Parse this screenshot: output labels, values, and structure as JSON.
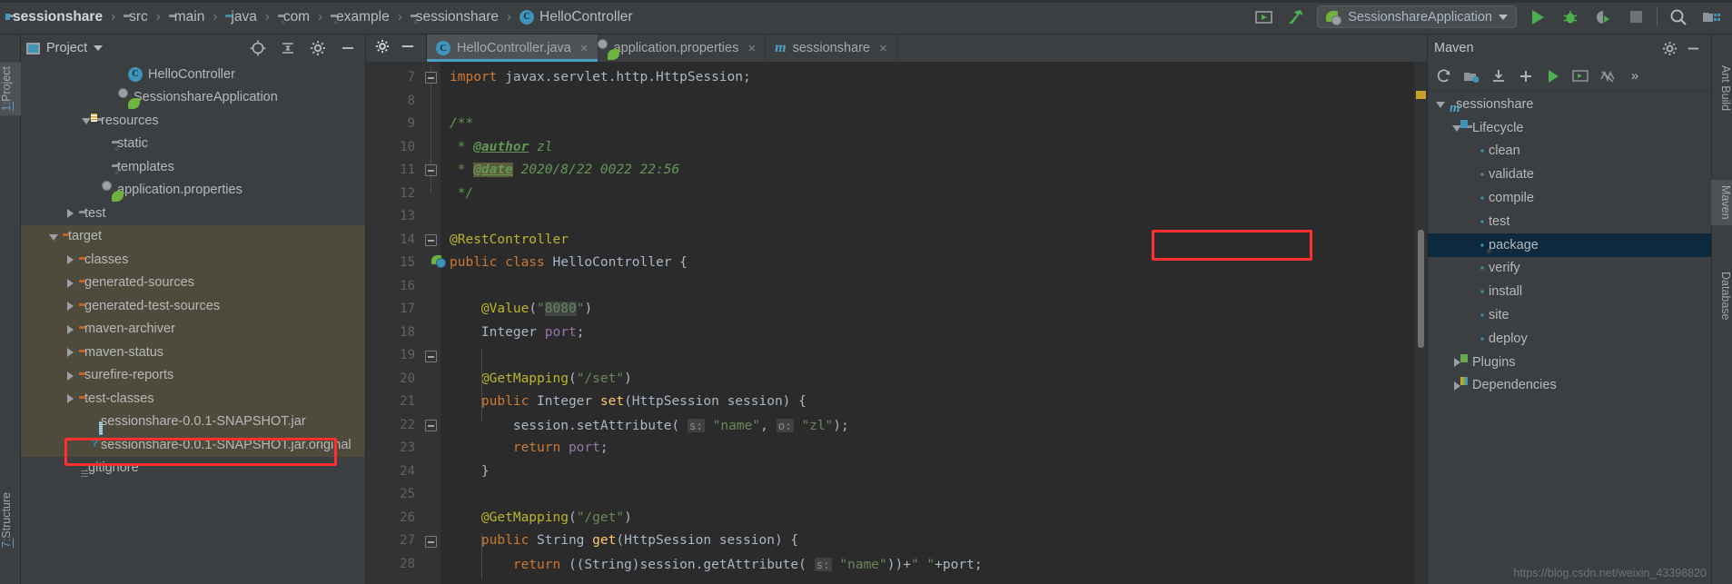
{
  "navbar": {
    "breadcrumbs": [
      {
        "label": "sessionshare",
        "icon": "project-folder-icon",
        "bold": true
      },
      {
        "label": "src",
        "icon": "folder-icon",
        "bold": false
      },
      {
        "label": "main",
        "icon": "folder-icon",
        "bold": false
      },
      {
        "label": "java",
        "icon": "source-folder-icon",
        "bold": false
      },
      {
        "label": "com",
        "icon": "package-folder-icon",
        "bold": false
      },
      {
        "label": "example",
        "icon": "package-folder-icon",
        "bold": false
      },
      {
        "label": "sessionshare",
        "icon": "package-folder-icon",
        "bold": false
      },
      {
        "label": "HelloController",
        "icon": "java-class-icon",
        "bold": false
      }
    ],
    "separator": "›",
    "run_config": "SessionshareApplication",
    "buttons": {
      "open_console": "open-console-icon",
      "build": "build-hammer-icon",
      "run": "run-icon",
      "debug": "debug-icon",
      "run_coverage": "run-with-coverage-icon",
      "stop": "stop-icon",
      "search": "search-everywhere-icon",
      "project_structure": "project-structure-icon"
    }
  },
  "left_strip": {
    "tabs": [
      {
        "num": "1:",
        "label": "Project",
        "active": true
      },
      {
        "num": "7:",
        "label": "Structure",
        "active": false
      }
    ]
  },
  "project_panel": {
    "title": "Project",
    "toolbar": [
      "locate-icon",
      "collapse-all-icon",
      "settings-gear-icon",
      "hide-icon"
    ],
    "tree": [
      {
        "label": "HelloController",
        "icon": "java-class-icon",
        "indent": 5,
        "arrow": "none"
      },
      {
        "label": "SessionshareApplication",
        "icon": "spring-boot-icon",
        "indent": 5,
        "arrow": "none"
      },
      {
        "label": "resources",
        "icon": "resources-folder-icon",
        "indent": 3,
        "arrow": "down"
      },
      {
        "label": "static",
        "icon": "package-folder-icon",
        "indent": 4,
        "arrow": "none"
      },
      {
        "label": "templates",
        "icon": "package-folder-icon",
        "indent": 4,
        "arrow": "none"
      },
      {
        "label": "application.properties",
        "icon": "spring-properties-icon",
        "indent": 4,
        "arrow": "none"
      },
      {
        "label": "test",
        "icon": "folder-icon",
        "indent": 2,
        "arrow": "right"
      },
      {
        "label": "target",
        "icon": "orange-folder-icon",
        "indent": 1,
        "arrow": "down",
        "highlight": true
      },
      {
        "label": "classes",
        "icon": "orange-folder-icon",
        "indent": 2,
        "arrow": "right",
        "highlight": true
      },
      {
        "label": "generated-sources",
        "icon": "orange-folder-icon",
        "indent": 2,
        "arrow": "right",
        "highlight": true
      },
      {
        "label": "generated-test-sources",
        "icon": "orange-folder-icon",
        "indent": 2,
        "arrow": "right",
        "highlight": true
      },
      {
        "label": "maven-archiver",
        "icon": "orange-folder-icon",
        "indent": 2,
        "arrow": "right",
        "highlight": true
      },
      {
        "label": "maven-status",
        "icon": "orange-folder-icon",
        "indent": 2,
        "arrow": "right",
        "highlight": true
      },
      {
        "label": "surefire-reports",
        "icon": "orange-folder-icon",
        "indent": 2,
        "arrow": "right",
        "highlight": true
      },
      {
        "label": "test-classes",
        "icon": "orange-folder-icon",
        "indent": 2,
        "arrow": "right",
        "highlight": true
      },
      {
        "label": "sessionshare-0.0.1-SNAPSHOT.jar",
        "icon": "jar-file-icon",
        "indent": 3,
        "arrow": "none",
        "highlight": true,
        "annotated": true
      },
      {
        "label": "sessionshare-0.0.1-SNAPSHOT.jar.original",
        "icon": "unknown-jar-icon",
        "indent": 3,
        "arrow": "none",
        "highlight": true
      },
      {
        "label": ".gitignore",
        "icon": "file-icon",
        "indent": 2,
        "arrow": "none"
      }
    ]
  },
  "editor": {
    "tabs": [
      {
        "label": "HelloController.java",
        "icon": "java-class-icon",
        "active": true,
        "close": "×"
      },
      {
        "label": "application.properties",
        "icon": "spring-properties-icon",
        "active": false,
        "close": "×"
      },
      {
        "label": "sessionshare",
        "icon": "maven-m-icon",
        "active": false,
        "close": "×"
      }
    ],
    "first_line_number": 7,
    "lines": [
      {
        "n": 7,
        "tokens": [
          {
            "t": "import ",
            "c": "kw"
          },
          {
            "t": "javax.servlet.http.HttpSession;",
            "c": "txt"
          }
        ]
      },
      {
        "n": 8,
        "tokens": []
      },
      {
        "n": 9,
        "tokens": [
          {
            "t": "/**",
            "c": "cmt"
          }
        ]
      },
      {
        "n": 10,
        "tokens": [
          {
            "t": " * ",
            "c": "cmt"
          },
          {
            "t": "@author",
            "c": "cmt-tag"
          },
          {
            "t": " zl",
            "c": "cmt"
          }
        ]
      },
      {
        "n": 11,
        "tokens": [
          {
            "t": " * ",
            "c": "cmt"
          },
          {
            "t": "@date",
            "c": "cmt-tag-hl"
          },
          {
            "t": " 2020/8/22 0022 22:56",
            "c": "cmt"
          }
        ]
      },
      {
        "n": 12,
        "tokens": [
          {
            "t": " */",
            "c": "cmt"
          }
        ]
      },
      {
        "n": 13,
        "tokens": []
      },
      {
        "n": 14,
        "tokens": [
          {
            "t": "@RestController",
            "c": "ann"
          }
        ]
      },
      {
        "n": 15,
        "tokens": [
          {
            "t": "public class ",
            "c": "kw"
          },
          {
            "t": "HelloController {",
            "c": "txt"
          }
        ]
      },
      {
        "n": 16,
        "tokens": []
      },
      {
        "n": 17,
        "tokens": [
          {
            "t": "    ",
            "c": "txt"
          },
          {
            "t": "@Value",
            "c": "ann"
          },
          {
            "t": "(",
            "c": "txt"
          },
          {
            "t": "\"",
            "c": "str"
          },
          {
            "t": "8080",
            "c": "str hl8080"
          },
          {
            "t": "\"",
            "c": "str"
          },
          {
            "t": ")",
            "c": "txt"
          }
        ]
      },
      {
        "n": 18,
        "tokens": [
          {
            "t": "    Integer ",
            "c": "txt"
          },
          {
            "t": "port",
            "c": "fld"
          },
          {
            "t": ";",
            "c": "txt"
          }
        ]
      },
      {
        "n": 19,
        "tokens": []
      },
      {
        "n": 20,
        "tokens": [
          {
            "t": "    ",
            "c": "txt"
          },
          {
            "t": "@GetMapping",
            "c": "ann"
          },
          {
            "t": "(",
            "c": "txt"
          },
          {
            "t": "\"/set\"",
            "c": "str"
          },
          {
            "t": ")",
            "c": "txt"
          }
        ]
      },
      {
        "n": 21,
        "tokens": [
          {
            "t": "    ",
            "c": "txt"
          },
          {
            "t": "public ",
            "c": "kw"
          },
          {
            "t": "Integer ",
            "c": "txt"
          },
          {
            "t": "set",
            "c": "mth"
          },
          {
            "t": "(HttpSession session) {",
            "c": "txt"
          }
        ]
      },
      {
        "n": 22,
        "tokens": [
          {
            "t": "        session.setAttribute( ",
            "c": "txt"
          },
          {
            "t": "s:",
            "c": "hint"
          },
          {
            "t": " ",
            "c": "txt"
          },
          {
            "t": "\"name\"",
            "c": "str"
          },
          {
            "t": ", ",
            "c": "txt"
          },
          {
            "t": "o:",
            "c": "hint"
          },
          {
            "t": " ",
            "c": "txt"
          },
          {
            "t": "\"zl\"",
            "c": "str"
          },
          {
            "t": ");",
            "c": "txt"
          }
        ]
      },
      {
        "n": 23,
        "tokens": [
          {
            "t": "        ",
            "c": "txt"
          },
          {
            "t": "return ",
            "c": "kw"
          },
          {
            "t": "port",
            "c": "fld"
          },
          {
            "t": ";",
            "c": "txt"
          }
        ]
      },
      {
        "n": 24,
        "tokens": [
          {
            "t": "    }",
            "c": "txt"
          }
        ]
      },
      {
        "n": 25,
        "tokens": []
      },
      {
        "n": 26,
        "tokens": [
          {
            "t": "    ",
            "c": "txt"
          },
          {
            "t": "@GetMapping",
            "c": "ann"
          },
          {
            "t": "(",
            "c": "txt"
          },
          {
            "t": "\"/get\"",
            "c": "str"
          },
          {
            "t": ")",
            "c": "txt"
          }
        ]
      },
      {
        "n": 27,
        "tokens": [
          {
            "t": "    ",
            "c": "txt"
          },
          {
            "t": "public ",
            "c": "kw"
          },
          {
            "t": "String ",
            "c": "txt"
          },
          {
            "t": "get",
            "c": "mth"
          },
          {
            "t": "(HttpSession session) {",
            "c": "txt"
          }
        ]
      },
      {
        "n": 28,
        "tokens": [
          {
            "t": "        ",
            "c": "txt"
          },
          {
            "t": "return ",
            "c": "kw"
          },
          {
            "t": "((String)session.getAttribute( ",
            "c": "txt"
          },
          {
            "t": "s:",
            "c": "hint"
          },
          {
            "t": " ",
            "c": "txt"
          },
          {
            "t": "\"name\"",
            "c": "str"
          },
          {
            "t": "))+",
            "c": "txt"
          },
          {
            "t": "\" \"",
            "c": "str"
          },
          {
            "t": "+port;",
            "c": "txt"
          }
        ]
      }
    ]
  },
  "maven": {
    "title": "Maven",
    "toolbar": [
      "reload-icon",
      "generate-sources-icon",
      "download-sources-icon",
      "add-icon",
      "run-maven-goal-icon",
      "execute-icon",
      "toggle-skip-tests-icon",
      "more-icon"
    ],
    "header_buttons": [
      "settings-gear-icon",
      "hide-icon"
    ],
    "tree": [
      {
        "label": "sessionshare",
        "icon": "maven-project-icon",
        "indent": 0,
        "arrow": "down"
      },
      {
        "label": "Lifecycle",
        "icon": "lifecycle-icon",
        "indent": 1,
        "arrow": "down"
      },
      {
        "label": "clean",
        "icon": "maven-goal-icon",
        "indent": 2,
        "arrow": "none"
      },
      {
        "label": "validate",
        "icon": "maven-goal-icon",
        "indent": 2,
        "arrow": "none"
      },
      {
        "label": "compile",
        "icon": "maven-goal-icon",
        "indent": 2,
        "arrow": "none"
      },
      {
        "label": "test",
        "icon": "maven-goal-icon",
        "indent": 2,
        "arrow": "none"
      },
      {
        "label": "package",
        "icon": "maven-goal-icon",
        "indent": 2,
        "arrow": "none",
        "selected": true,
        "annotated": true
      },
      {
        "label": "verify",
        "icon": "maven-goal-icon",
        "indent": 2,
        "arrow": "none"
      },
      {
        "label": "install",
        "icon": "maven-goal-icon",
        "indent": 2,
        "arrow": "none"
      },
      {
        "label": "site",
        "icon": "maven-goal-icon",
        "indent": 2,
        "arrow": "none"
      },
      {
        "label": "deploy",
        "icon": "maven-goal-icon",
        "indent": 2,
        "arrow": "none"
      },
      {
        "label": "Plugins",
        "icon": "plugins-icon",
        "indent": 1,
        "arrow": "right"
      },
      {
        "label": "Dependencies",
        "icon": "dependencies-icon",
        "indent": 1,
        "arrow": "right"
      }
    ]
  },
  "right_strip": {
    "tabs": [
      {
        "label": "Ant Build",
        "active": false
      },
      {
        "label": "Maven",
        "active": true
      },
      {
        "label": "Database",
        "active": false
      }
    ]
  },
  "watermark": "https://blog.csdn.net/weixin_43398820",
  "colors": {
    "accent_blue": "#3d93b8",
    "annotation_red": "#ff2f2f",
    "selection_blue": "#0d293e",
    "target_highlight": "#4f4b3c",
    "run_green": "#4caf50"
  }
}
